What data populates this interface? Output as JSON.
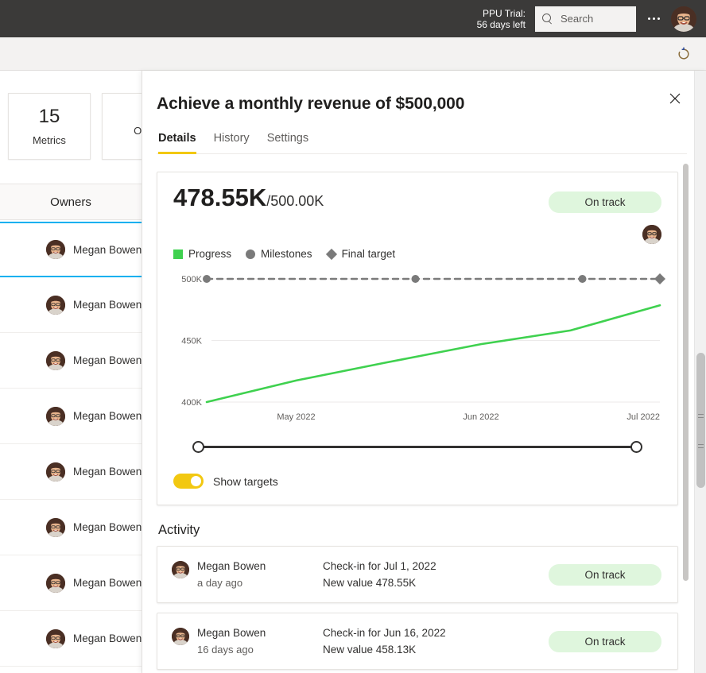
{
  "appbar": {
    "trial_line1": "PPU Trial:",
    "trial_line2": "56 days left",
    "search_placeholder": "Search",
    "search_icon": "search-icon",
    "more_icon": "ellipsis-icon",
    "avatar_alt": "Megan Bowen"
  },
  "toolbar": {
    "refresh_icon": "refresh-icon"
  },
  "background": {
    "tiles": [
      {
        "value": "15",
        "label": "Metrics"
      },
      {
        "value": "",
        "label": "Ove"
      }
    ],
    "owners_header": "Owners",
    "owner_rows": [
      {
        "name": "Megan Bowen",
        "selected": true
      },
      {
        "name": "Megan Bowen",
        "selected": false
      },
      {
        "name": "Megan Bowen",
        "selected": false
      },
      {
        "name": "Megan Bowen",
        "selected": false
      },
      {
        "name": "Megan Bowen",
        "selected": false
      },
      {
        "name": "Megan Bowen",
        "selected": false
      },
      {
        "name": "Megan Bowen",
        "selected": false
      },
      {
        "name": "Megan Bowen",
        "selected": false
      }
    ]
  },
  "panel": {
    "title": "Achieve a monthly revenue of $500,000",
    "close_icon": "close-icon",
    "tabs": [
      {
        "label": "Details",
        "active": true
      },
      {
        "label": "History",
        "active": false
      },
      {
        "label": "Settings",
        "active": false
      }
    ]
  },
  "metric": {
    "current_value": "478.55K",
    "target_value": "/500.00K",
    "status": "On track",
    "owner_avatar_alt": "Megan Bowen",
    "legend": [
      {
        "label": "Progress",
        "marker": "square",
        "color": "#3fd14f"
      },
      {
        "label": "Milestones",
        "marker": "circle",
        "color": "#7a7a7a"
      },
      {
        "label": "Final target",
        "marker": "diamond",
        "color": "#7a7a7a"
      }
    ],
    "show_targets_label": "Show targets",
    "show_targets_on": true,
    "slider": {
      "left_handle": "range-start-handle",
      "right_handle": "range-end-handle"
    }
  },
  "chart_data": {
    "type": "line",
    "title": "",
    "xlabel": "",
    "ylabel": "",
    "ylim": [
      400000,
      500000
    ],
    "ytick_labels": [
      "500K",
      "450K",
      "400K"
    ],
    "ytick_values": [
      500000,
      450000,
      400000
    ],
    "xtick_labels": [
      "May 2022",
      "Jun 2022",
      "Jul 2022"
    ],
    "x_axis_range": [
      "2022-04-16",
      "2022-07-01"
    ],
    "grid": true,
    "legend_position": "top-left",
    "series": [
      {
        "name": "Progress",
        "type": "line",
        "color": "#3fd14f",
        "style": "solid",
        "x": [
          "2022-04-16",
          "2022-05-01",
          "2022-05-16",
          "2022-06-01",
          "2022-06-16",
          "2022-07-01"
        ],
        "values": [
          400000,
          417500,
          432000,
          447000,
          458130,
          478550
        ]
      },
      {
        "name": "Final target",
        "type": "line",
        "color": "#7a7a7a",
        "style": "dashed",
        "x": [
          "2022-04-16",
          "2022-07-01"
        ],
        "values": [
          500000,
          500000
        ]
      }
    ],
    "markers": [
      {
        "series": "Milestones",
        "shape": "circle",
        "x": "2022-04-16",
        "value": 500000
      },
      {
        "series": "Milestones",
        "shape": "circle",
        "x": "2022-05-21",
        "value": 500000
      },
      {
        "series": "Milestones",
        "shape": "circle",
        "x": "2022-06-18",
        "value": 500000
      },
      {
        "series": "Final target",
        "shape": "diamond",
        "x": "2022-07-01",
        "value": 500000
      }
    ]
  },
  "activity": {
    "heading": "Activity",
    "items": [
      {
        "user": "Megan Bowen",
        "when": "a day ago",
        "checkin": "Check-in for Jul 1, 2022",
        "new_value": "New value 478.55K",
        "status": "On track"
      },
      {
        "user": "Megan Bowen",
        "when": "16 days ago",
        "checkin": "Check-in for Jun 16, 2022",
        "new_value": "New value 458.13K",
        "status": "On track"
      }
    ]
  },
  "colors": {
    "appbar_bg": "#3b3a39",
    "toolbar_bg": "#f3f2f1",
    "accent_yellow": "#f2c811",
    "progress_green": "#3fd14f",
    "badge_green_bg": "#dff6dd",
    "selection_cyan": "#00b0f0",
    "target_gray": "#7a7a7a"
  }
}
